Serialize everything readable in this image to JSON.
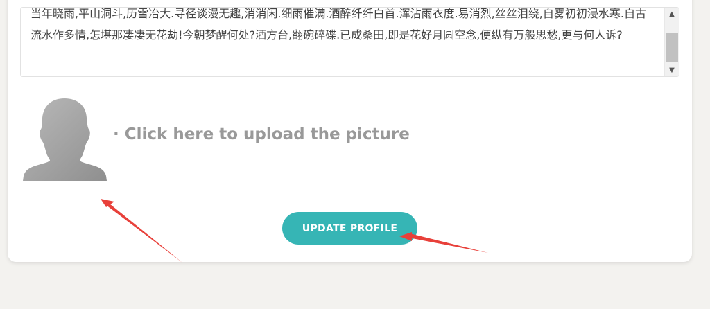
{
  "bio": {
    "text": "当年晓雨,平山洞斗,历雪冶大.寻径谈漫无趣,消消闲.细雨催满.酒醉纤纤白首.浑沾雨衣度.易消烈,丝丝泪绕,自雾初初浸水寒.自古流水作多情,怎堪那凄凄无花劫!今朝梦醒何处?酒方台,翻碗碎碟.已成桑田,即是花好月圆空念,便纵有万般思愁,更与何人诉?"
  },
  "avatar": {
    "icon": "user-silhouette"
  },
  "upload": {
    "label": "· Click here to upload the picture"
  },
  "update_button": {
    "label": "UPDATE PROFILE",
    "color": "#36b5b5"
  },
  "annotation": {
    "arrow_color": "#e8403a"
  },
  "page": {
    "background": "#f3f2ef"
  }
}
